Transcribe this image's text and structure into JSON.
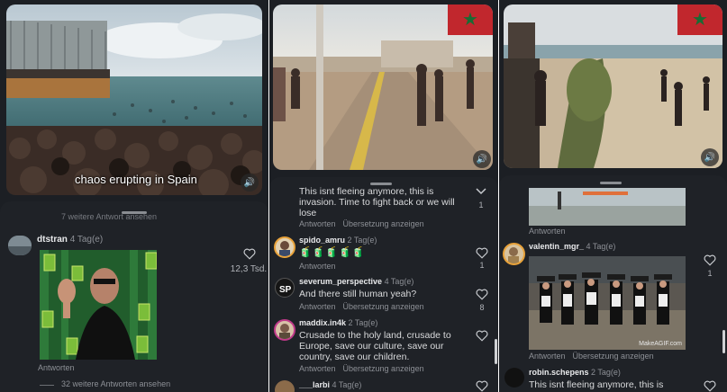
{
  "panel1": {
    "video_caption": "chaos erupting in Spain",
    "more_replies_top": "7 weitere Antwort ansehen",
    "comment": {
      "user": "dtstran",
      "time": "4 Tag(e)",
      "likes": "12,3 Tsd."
    },
    "reply_label": "Antworten",
    "more_replies": "32 weitere Antworten ansehen"
  },
  "panel2": {
    "comments": [
      {
        "text_line1": "This isnt fleeing anymore, this is",
        "text_line2": "invasion. Time to fight back or we will",
        "text_line3": "lose",
        "likes": "1"
      },
      {
        "user": "spido_amru",
        "time": "2 Tag(e)",
        "emojis": "🧃🧃🧃🧃🧃",
        "likes": "1"
      },
      {
        "user": "severum_perspective",
        "time": "4 Tag(e)",
        "text": "And there still human yeah?",
        "likes": "8"
      },
      {
        "user": "maddix.in4k",
        "time": "2 Tag(e)",
        "text_line1": "Crusade to the holy land, crusade to",
        "text_line2": "Europe, save our culture, save our",
        "text_line3": "country, save our children."
      },
      {
        "user": "___larbi",
        "time": "4 Tag(e)"
      }
    ],
    "reply_label": "Antworten",
    "translate_label": "Übersetzung anzeigen"
  },
  "panel3": {
    "comments": [
      {
        "user": "valentin_mgr_",
        "time": "4 Tag(e)",
        "likes": "1"
      },
      {
        "user": "robin.schepens",
        "time": "2 Tag(e)",
        "text": "This isnt fleeing anymore, this is"
      }
    ],
    "gif_watermark": "MakeAGIF.com",
    "reply_label": "Antworten",
    "translate_label": "Übersetzung anzeigen"
  },
  "colors": {
    "panel_bg": "#1c1f24",
    "flag_red": "#c1272d",
    "flag_star": "#1a6b33"
  }
}
